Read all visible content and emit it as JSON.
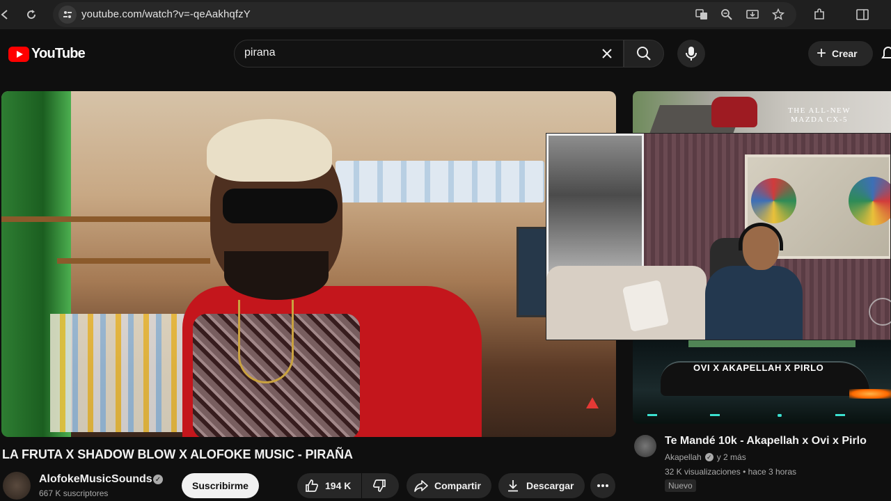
{
  "browser": {
    "url": "youtube.com/watch?v=-qeAakhqfzY",
    "icons": [
      "back-icon",
      "reload-icon",
      "site-info-icon",
      "translate-icon",
      "zoom-icon",
      "install-app-icon",
      "bookmark-star-icon",
      "extensions-icon",
      "side-panel-icon"
    ]
  },
  "header": {
    "logo_text": "YouTube",
    "search_value": "pirana",
    "create_label": "Crear"
  },
  "ad": {
    "text_line1": "THE ALL-NEW",
    "text_line2": "MAZDA CX-5"
  },
  "video": {
    "title": "LA FRUTA X SHADOW BLOW X ALOFOKE MUSIC - PIRAÑA",
    "channel": "AlofokeMusicSounds",
    "subscribers": "667 K suscriptores",
    "subscribe_label": "Suscribirme",
    "likes": "194 K",
    "share_label": "Compartir",
    "download_label": "Descargar"
  },
  "recommendation": {
    "thumb_overlay": "OVI  X  AKAPELLAH  X  PIRLO",
    "title": "Te Mandé 10k - Akapellah x Ovi x Pirlo",
    "channel": "Akapellah",
    "age": "y 2 más",
    "views": "32 K visualizaciones",
    "time": "hace 3 horas",
    "badge": "Nuevo"
  },
  "colors": {
    "background": "#0f0f0f",
    "brand_red": "#ff0000",
    "pill": "#272727",
    "text_secondary": "#aaaaaa"
  }
}
